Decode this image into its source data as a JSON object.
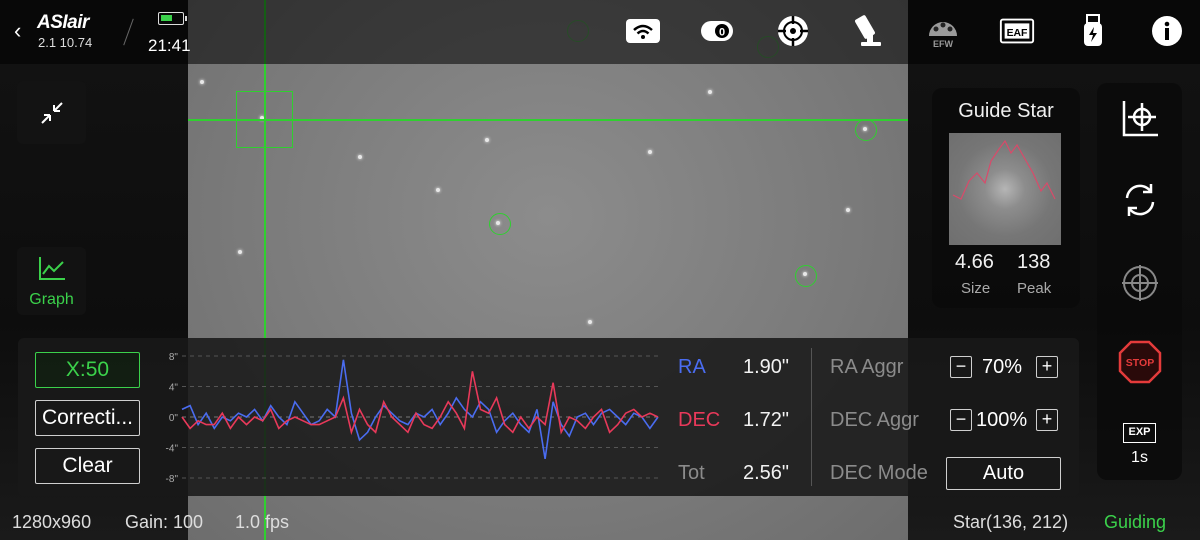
{
  "app": {
    "brand": "ASIair",
    "version": "2.1 10.74",
    "clock": "21:41",
    "battery_level": 0.55
  },
  "top_icons": [
    "wifi-icon",
    "camera-icon",
    "guide-scope-icon",
    "telescope-mount-icon",
    "filter-wheel-icon",
    "focuser-icon",
    "usb-drive-icon",
    "info-icon"
  ],
  "top_icon_labels": {
    "efw": "EFW",
    "eaf": "EAF"
  },
  "left": {
    "graph_label": "Graph"
  },
  "guide_star": {
    "title": "Guide Star",
    "size_value": "4.66",
    "size_label": "Size",
    "peak_value": "138",
    "peak_label": "Peak"
  },
  "right_bar": {
    "exp_label": "EXP",
    "exp_value": "1s",
    "stop_label": "STOP"
  },
  "guide_panel": {
    "x_scale_button": "X:50",
    "correction_button": "Correcti...",
    "clear_button": "Clear",
    "y_ticks": [
      "8\"",
      "4\"",
      "0\"",
      "-4\"",
      "-8\""
    ],
    "ra_label": "RA",
    "ra_value": "1.90\"",
    "dec_label": "DEC",
    "dec_value": "1.72\"",
    "tot_label": "Tot",
    "tot_value": "2.56\"",
    "ra_aggr_label": "RA Aggr",
    "ra_aggr_value": "70%",
    "dec_aggr_label": "DEC Aggr",
    "dec_aggr_value": "100%",
    "dec_mode_label": "DEC Mode",
    "dec_mode_value": "Auto",
    "colors": {
      "ra": "#4a6cf0",
      "dec": "#e8395a"
    }
  },
  "status_bar": {
    "resolution": "1280x960",
    "gain": "Gain: 100",
    "fps": "1.0 fps",
    "star_pos": "Star(136, 212)",
    "state": "Guiding",
    "state_color": "#3bd14b"
  },
  "chart_data": {
    "type": "line",
    "ylim": [
      -8,
      8
    ],
    "y_ticks": [
      8,
      4,
      0,
      -4,
      -8
    ],
    "series": [
      {
        "name": "RA",
        "color": "#4a6cf0",
        "values": [
          1,
          1.5,
          -1,
          0.5,
          -1.5,
          0,
          -0.5,
          0.5,
          0,
          1,
          -0.5,
          1.5,
          0,
          -1,
          2,
          0.5,
          -1,
          -0.5,
          1,
          0,
          7.5,
          0.5,
          -3,
          -2,
          0,
          1.5,
          0.5,
          -0.5,
          -1,
          0.5,
          0,
          1,
          -1,
          0.5,
          2.5,
          1,
          0,
          2,
          1,
          -2,
          -0.5,
          0.5,
          -1,
          -2,
          1,
          -5.5,
          2,
          -1,
          -2.5,
          0,
          0.5,
          -1,
          0.5,
          1,
          0,
          -1,
          0.5,
          0,
          -1.5,
          0
        ]
      },
      {
        "name": "DEC",
        "color": "#e8395a",
        "values": [
          0,
          -1.5,
          -0.5,
          -1,
          -1,
          0.5,
          -1.5,
          0,
          -1,
          0,
          -0.5,
          1,
          -1.5,
          -0.5,
          0,
          -0.5,
          -1,
          -1,
          -0.5,
          0,
          2.5,
          -2,
          1,
          -1,
          -2,
          2,
          0,
          -1,
          -2,
          0.5,
          -1,
          -1.5,
          0,
          2,
          0.5,
          -1.5,
          6,
          1,
          0.5,
          2.5,
          -1,
          -2,
          0,
          -1.5,
          0,
          -1,
          4.5,
          -2,
          0,
          -0.5,
          -1.5,
          0,
          1,
          -2,
          -1,
          0.5,
          1,
          0,
          0.5,
          0
        ]
      }
    ]
  }
}
